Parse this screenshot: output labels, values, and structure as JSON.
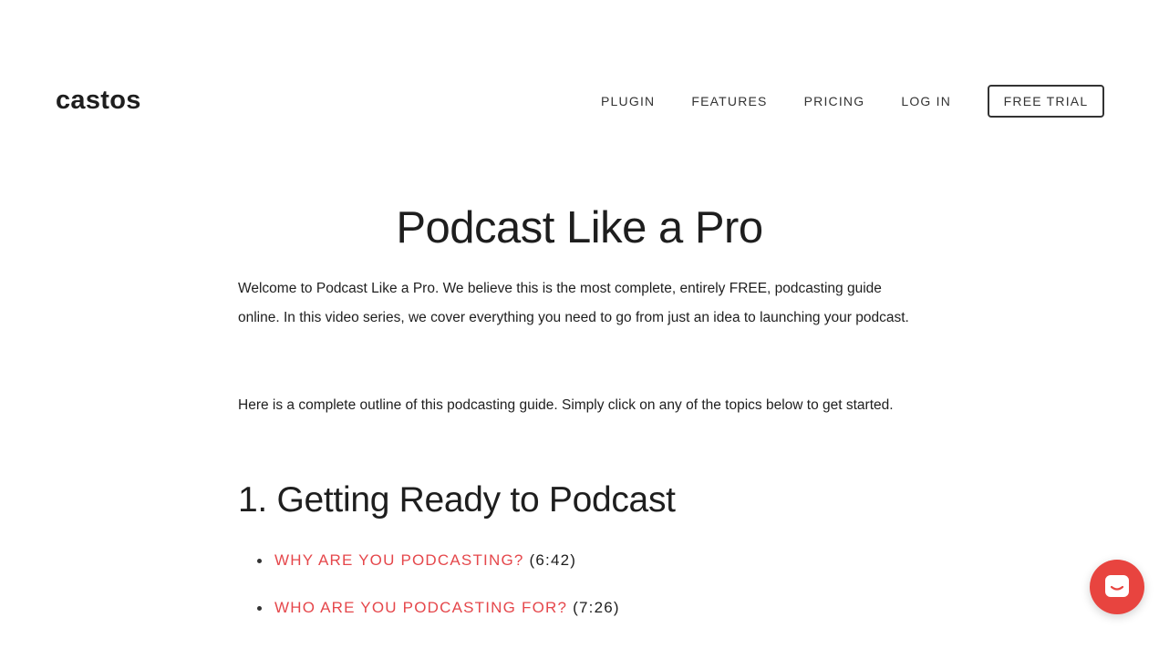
{
  "header": {
    "logo": "castos",
    "nav": {
      "plugin": "PLUGIN",
      "features": "FEATURES",
      "pricing": "PRICING",
      "login": "LOG IN",
      "cta": "FREE TRIAL"
    }
  },
  "main": {
    "title": "Podcast Like a Pro",
    "intro_1": "Welcome to Podcast Like a Pro.  We believe this is the most complete, entirely FREE, podcasting guide online.  In this video series, we cover everything you need to go from just an idea to launching your podcast.",
    "intro_2": "Here is a complete outline of this podcasting guide.  Simply click on any of the topics below to get started.",
    "section_1": {
      "heading": "1. Getting Ready to Podcast",
      "topics": [
        {
          "label": "WHY ARE YOU PODCASTING?",
          "duration": "(6:42)"
        },
        {
          "label": "WHO ARE YOU PODCASTING FOR?",
          "duration": "(7:26)"
        }
      ]
    }
  },
  "chat_widget": {
    "icon": "chat-icon"
  },
  "colors": {
    "accent": "#e5474b",
    "chat_bg": "#e8443f",
    "text": "#1e1e1e"
  }
}
